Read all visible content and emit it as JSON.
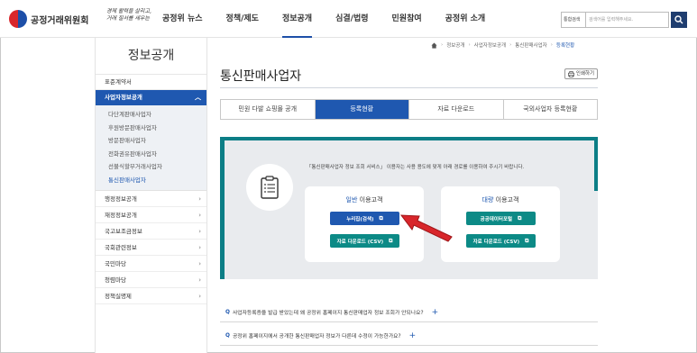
{
  "header": {
    "logo_text": "공정거래위원회",
    "slogan_line1": "경제 활력을 살리고,",
    "slogan_line2": "거래 질서를 세우는",
    "nav": [
      "공정위 뉴스",
      "정책/제도",
      "정보공개",
      "심결/법령",
      "민원참여",
      "공정위 소개"
    ],
    "search_select": "통합검색",
    "search_placeholder": "검색어를 입력해주세요."
  },
  "sidebar": {
    "title": "정보공개",
    "items_before": [
      "표준계약서"
    ],
    "open_item": "사업자정보공개",
    "sub_items": [
      "다단계판매사업자",
      "후원방문판매사업자",
      "방문판매사업자",
      "전화권유판매사업자",
      "선불식할부거래사업자",
      "통신판매사업자"
    ],
    "active_sub": "통신판매사업자",
    "items_after": [
      "행정정보공개",
      "재정정보공개",
      "국고보조금정보",
      "국회관련정보",
      "국민마당",
      "청렴마당",
      "정책실명제"
    ]
  },
  "breadcrumb": [
    "정보공개",
    "사업자정보공개",
    "통신판매사업자",
    "등록현황"
  ],
  "page": {
    "title": "통신판매사업자",
    "print_label": "인쇄하기"
  },
  "tabs": [
    "민원 다발 쇼핑몰 공개",
    "등록현황",
    "자료 다운로드",
    "국외사업자 등록현황"
  ],
  "active_tab": "등록현황",
  "content": {
    "intro": "「통신판매사업자 정보 조회 서비스」 이용자는 사용 용도에 맞게 아래 경로를 이용하여 주시기 바랍니다.",
    "general_card": {
      "title_highlight": "일반",
      "title_rest": " 이용고객",
      "btn_primary": "누리집(검색)",
      "btn_secondary": "자료 다운로드 (CSV)"
    },
    "bulk_card": {
      "title_highlight": "대량",
      "title_rest": " 이용고객",
      "btn_primary": "공공데이터포털",
      "btn_secondary": "자료 다운로드 (CSV)"
    }
  },
  "faq": [
    "사업자등록증을 발급 받았는데 왜 공정위 홈페이지 통신판매업자 정보 조회가 안되나요?",
    "공정위 홈페이지에서 공개한 통신판매업자 정보가 다른데 수정이 가능한가요?"
  ],
  "colors": {
    "primary": "#1f58b0",
    "teal": "#0c8a86",
    "arrow": "#d8262b"
  }
}
